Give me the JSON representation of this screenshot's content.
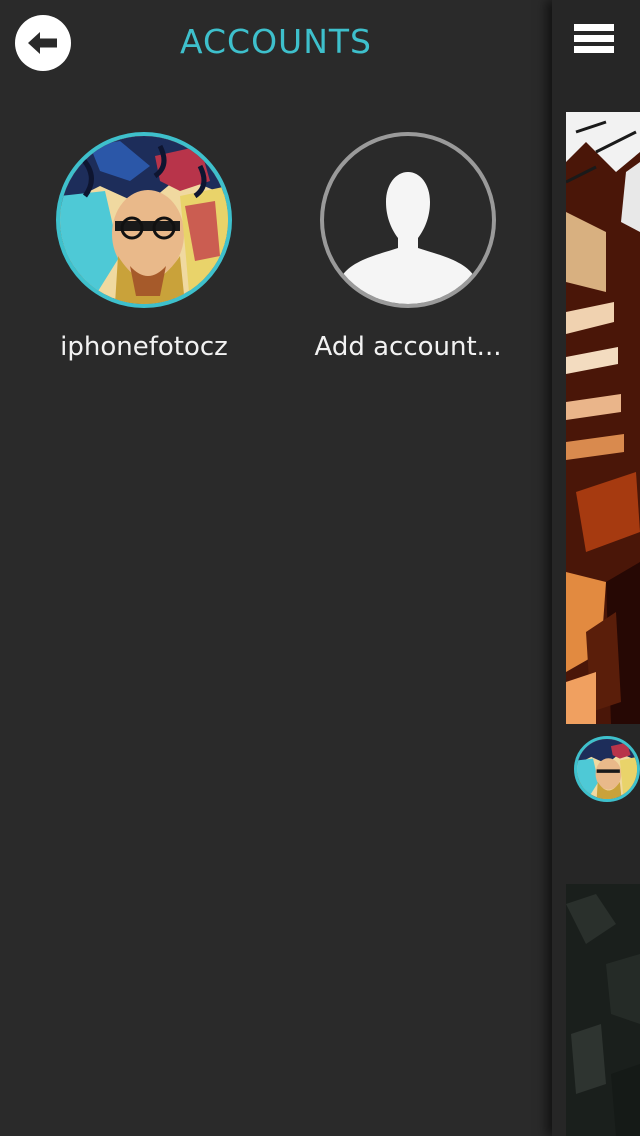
{
  "drawer": {
    "title": "ACCOUNTS",
    "back_icon": "arrow-left-icon"
  },
  "accounts": [
    {
      "label": "iphonefotocz",
      "avatar": "user-avatar-image"
    },
    {
      "label": "Add account...",
      "avatar": "person-silhouette-icon"
    }
  ],
  "feed": {
    "menu_icon": "hamburger-menu-icon"
  },
  "colors": {
    "accent": "#3ec0cc",
    "background": "#2a2a2a",
    "text": "#f2f2f2"
  }
}
